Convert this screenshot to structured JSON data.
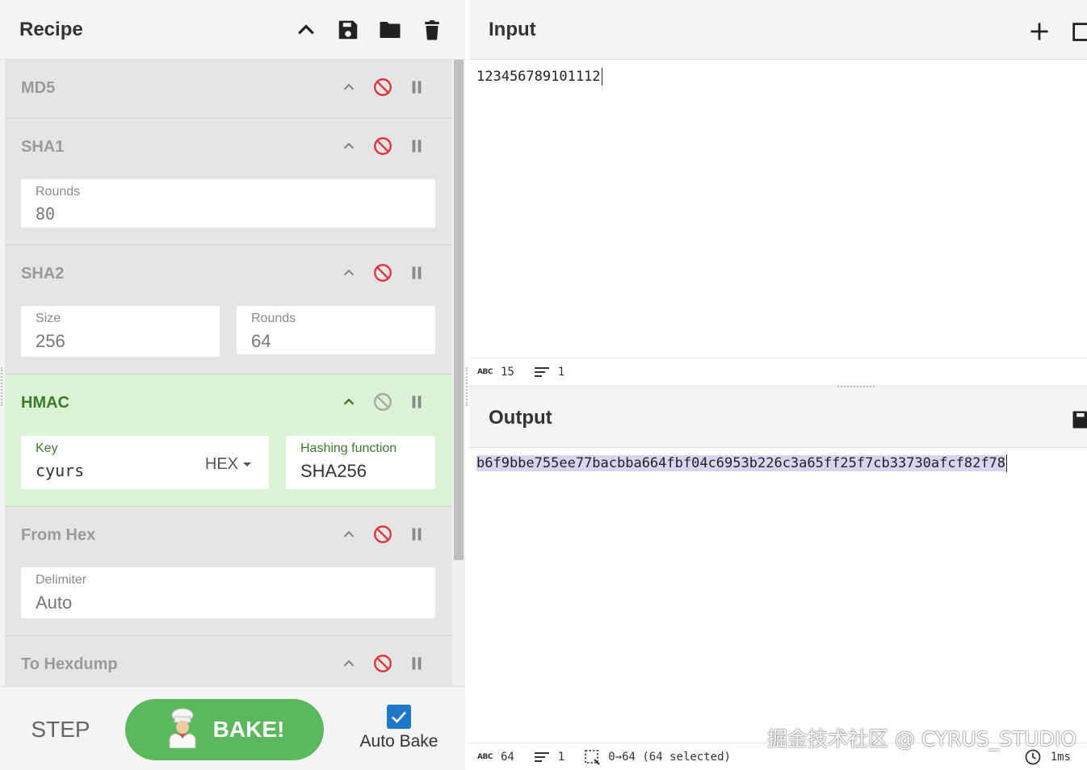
{
  "recipe": {
    "title": "Recipe",
    "actions": {
      "collapse": "chevron-up-icon",
      "save": "save-icon",
      "load": "folder-icon",
      "clear": "trash-icon"
    },
    "operations": [
      {
        "name": "MD5",
        "fields": []
      },
      {
        "name": "SHA1",
        "fields": [
          {
            "label": "Rounds",
            "value": "80"
          }
        ]
      },
      {
        "name": "SHA2",
        "fields": [
          {
            "label": "Size",
            "value": "256"
          },
          {
            "label": "Rounds",
            "value": "64"
          }
        ]
      },
      {
        "name": "HMAC",
        "fields": [
          {
            "label": "Key",
            "value": "cyurs",
            "option": "HEX"
          },
          {
            "label": "Hashing function",
            "value": "SHA256"
          }
        ]
      },
      {
        "name": "From Hex",
        "fields": [
          {
            "label": "Delimiter",
            "value": "Auto"
          }
        ]
      },
      {
        "name": "To Hexdump",
        "fields": []
      }
    ],
    "controls": {
      "step": "STEP",
      "bake": "BAKE!",
      "auto_bake": "Auto Bake",
      "auto_bake_checked": true
    }
  },
  "input": {
    "title": "Input",
    "text": "123456789101112",
    "status": {
      "length_label": "ABC",
      "length": "15",
      "lines": "1"
    }
  },
  "output": {
    "title": "Output",
    "text": "b6f9bbe755ee77bacbba664fbf04c6953b226c3a65ff25f7cb33730afcf82f78",
    "status": {
      "length_label": "ABC",
      "length": "64",
      "lines": "1",
      "selection": "0→64 (64 selected)",
      "time": "1ms"
    }
  },
  "watermark": "掘金技术社区 @ CYRUS_STUDIO",
  "colors": {
    "accent_green": "#5cb85c",
    "active_op_bg": "#dcf2d5",
    "disable_red": "#e0353f",
    "checkbox_blue": "#1e78c8"
  }
}
